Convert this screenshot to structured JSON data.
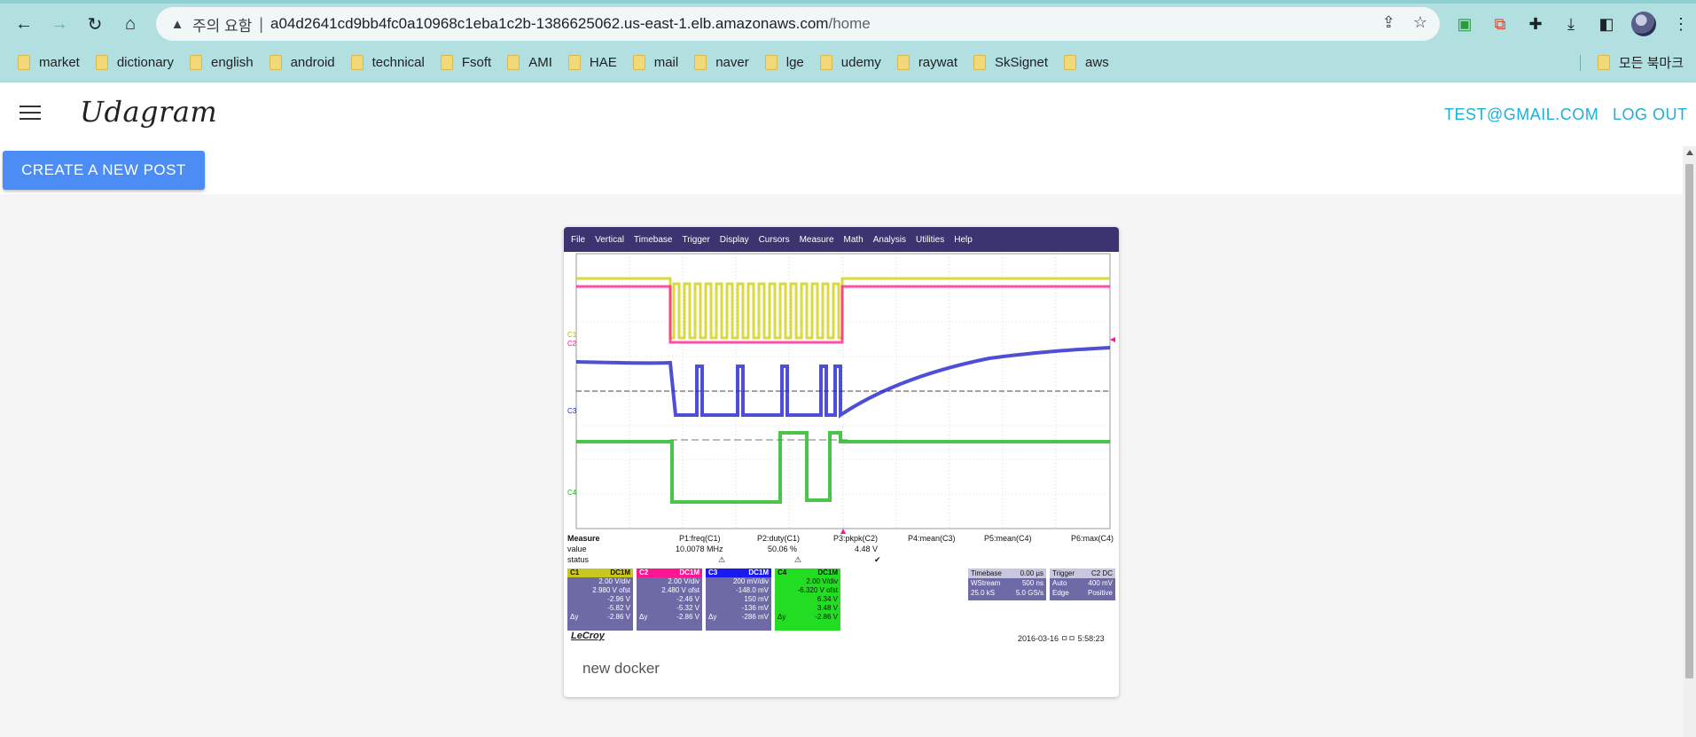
{
  "browser": {
    "warning_text": "주의 요함",
    "url_host": "a04d2641cd9bb4fc0a10968c1eba1c2b-1386625062.us-east-1.elb.amazonaws.com",
    "url_path": "/home",
    "bookmarks": [
      "market",
      "dictionary",
      "english",
      "android",
      "technical",
      "Fsoft",
      "AMI",
      "HAE",
      "mail",
      "naver",
      "lge",
      "udemy",
      "raywat",
      "SkSignet",
      "aws"
    ],
    "other_bookmarks": "모든 북마크"
  },
  "app": {
    "brand": "Udagram",
    "user_email": "TEST@GMAIL.COM",
    "logout_label": "LOG OUT",
    "new_post_label": "CREATE A NEW POST"
  },
  "post": {
    "caption": "new docker",
    "scope": {
      "menu": [
        "File",
        "Vertical",
        "Timebase",
        "Trigger",
        "Display",
        "Cursors",
        "Measure",
        "Math",
        "Analysis",
        "Utilities",
        "Help"
      ],
      "measure_header": [
        "Measure",
        "P1:freq(C1)",
        "P2:duty(C1)",
        "P3:pkpk(C2)",
        "P4:mean(C3)",
        "P5:mean(C4)",
        "P6:max(C4)"
      ],
      "value_row": [
        "value",
        "10.0078 MHz",
        "50.06 %",
        "4.48 V"
      ],
      "status_label": "status",
      "channels": [
        {
          "name": "C1",
          "coupling": "DC1M",
          "color": "#e8e830",
          "lines": [
            "2.00 V/div",
            "2.980 V ofst",
            "-2.96 V",
            "-5.82 V",
            "-2.86 V"
          ]
        },
        {
          "name": "C2",
          "coupling": "DC1M",
          "color": "#ff1493",
          "lines": [
            "2.00 V/div",
            "2.480 V ofst",
            "-2.46 V",
            "-5.32 V",
            "-2.86 V"
          ]
        },
        {
          "name": "C3",
          "coupling": "DC1M",
          "color": "#1a1aff",
          "lines": [
            "200 mV/div",
            "-148.0 mV",
            "150 mV",
            "-136 mV",
            "-286 mV"
          ]
        },
        {
          "name": "C4",
          "coupling": "DC1M",
          "color": "#22dd22",
          "lines": [
            "2.00 V/div",
            "-6.320 V ofst",
            "6.34 V",
            "3.48 V",
            "-2.86 V"
          ]
        }
      ],
      "delta_label": "Δy",
      "timebase": {
        "label": "Timebase",
        "value": "0.00 µs",
        "r1a": "WStream",
        "r1b": "500 ns",
        "r2a": "25.0 kS",
        "r2b": "5.0 GS/s"
      },
      "trigger": {
        "label": "Trigger",
        "value": "C2 DC",
        "r1a": "Auto",
        "r1b": "400 mV",
        "r2a": "Edge",
        "r2b": "Positive"
      },
      "brand": "LeCroy",
      "timestamp": "2016-03-16 ㅁㅁ 5:58:23",
      "trace_labels": [
        "C1",
        "C2",
        "C3",
        "C4"
      ]
    }
  }
}
